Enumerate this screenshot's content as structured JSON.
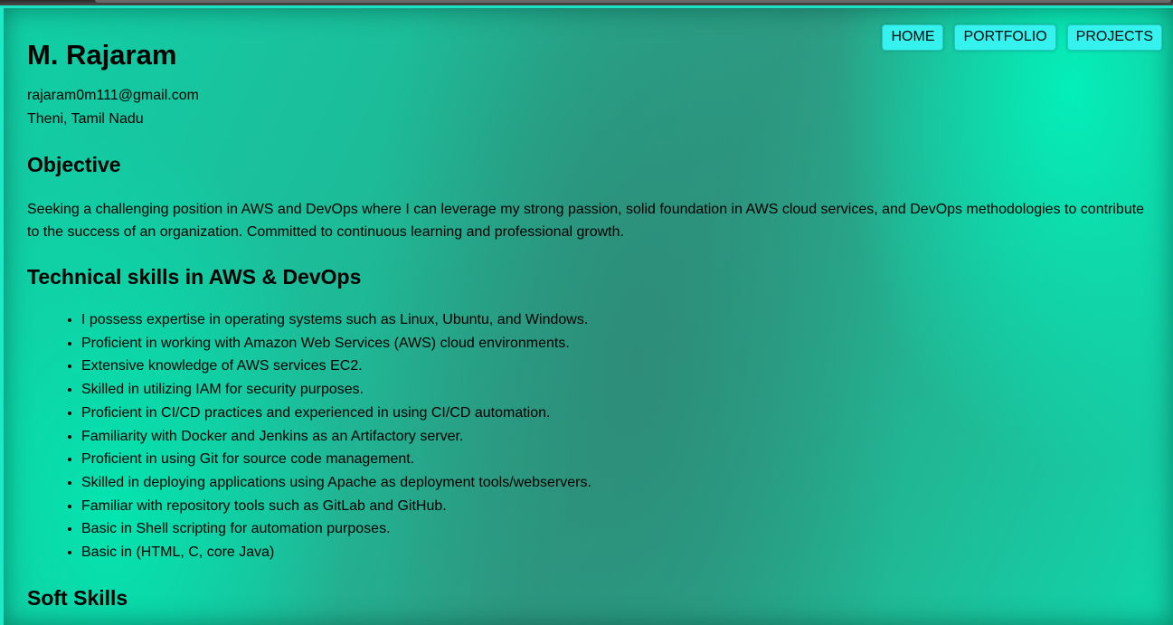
{
  "nav": {
    "home": "HOME",
    "portfolio": "PORTFOLIO",
    "projects": "PROJECTS"
  },
  "profile": {
    "name": "M. Rajaram",
    "email": "rajaram0m111@gmail.com",
    "location": "Theni, Tamil Nadu"
  },
  "objective": {
    "heading": "Objective",
    "text": "Seeking a challenging position in AWS and DevOps where I can leverage my strong passion, solid foundation in AWS cloud services, and DevOps methodologies to contribute to the success of an organization. Committed to continuous learning and professional growth."
  },
  "technical": {
    "heading": "Technical skills in AWS & DevOps",
    "items": [
      "I possess expertise in operating systems such as Linux, Ubuntu, and Windows.",
      "Proficient in working with Amazon Web Services (AWS) cloud environments.",
      "Extensive knowledge of AWS services EC2.",
      "Skilled in utilizing IAM for security purposes.",
      "Proficient in CI/CD practices and experienced in using CI/CD automation.",
      "Familiarity with Docker and Jenkins as an Artifactory server.",
      "Proficient in using Git for source code management.",
      "Skilled in deploying applications using Apache as deployment tools/webservers.",
      "Familiar with repository tools such as GitLab and GitHub.",
      "Basic in Shell scripting for automation purposes.",
      "Basic in (HTML, C, core Java)"
    ]
  },
  "soft": {
    "heading": "Soft Skills"
  }
}
